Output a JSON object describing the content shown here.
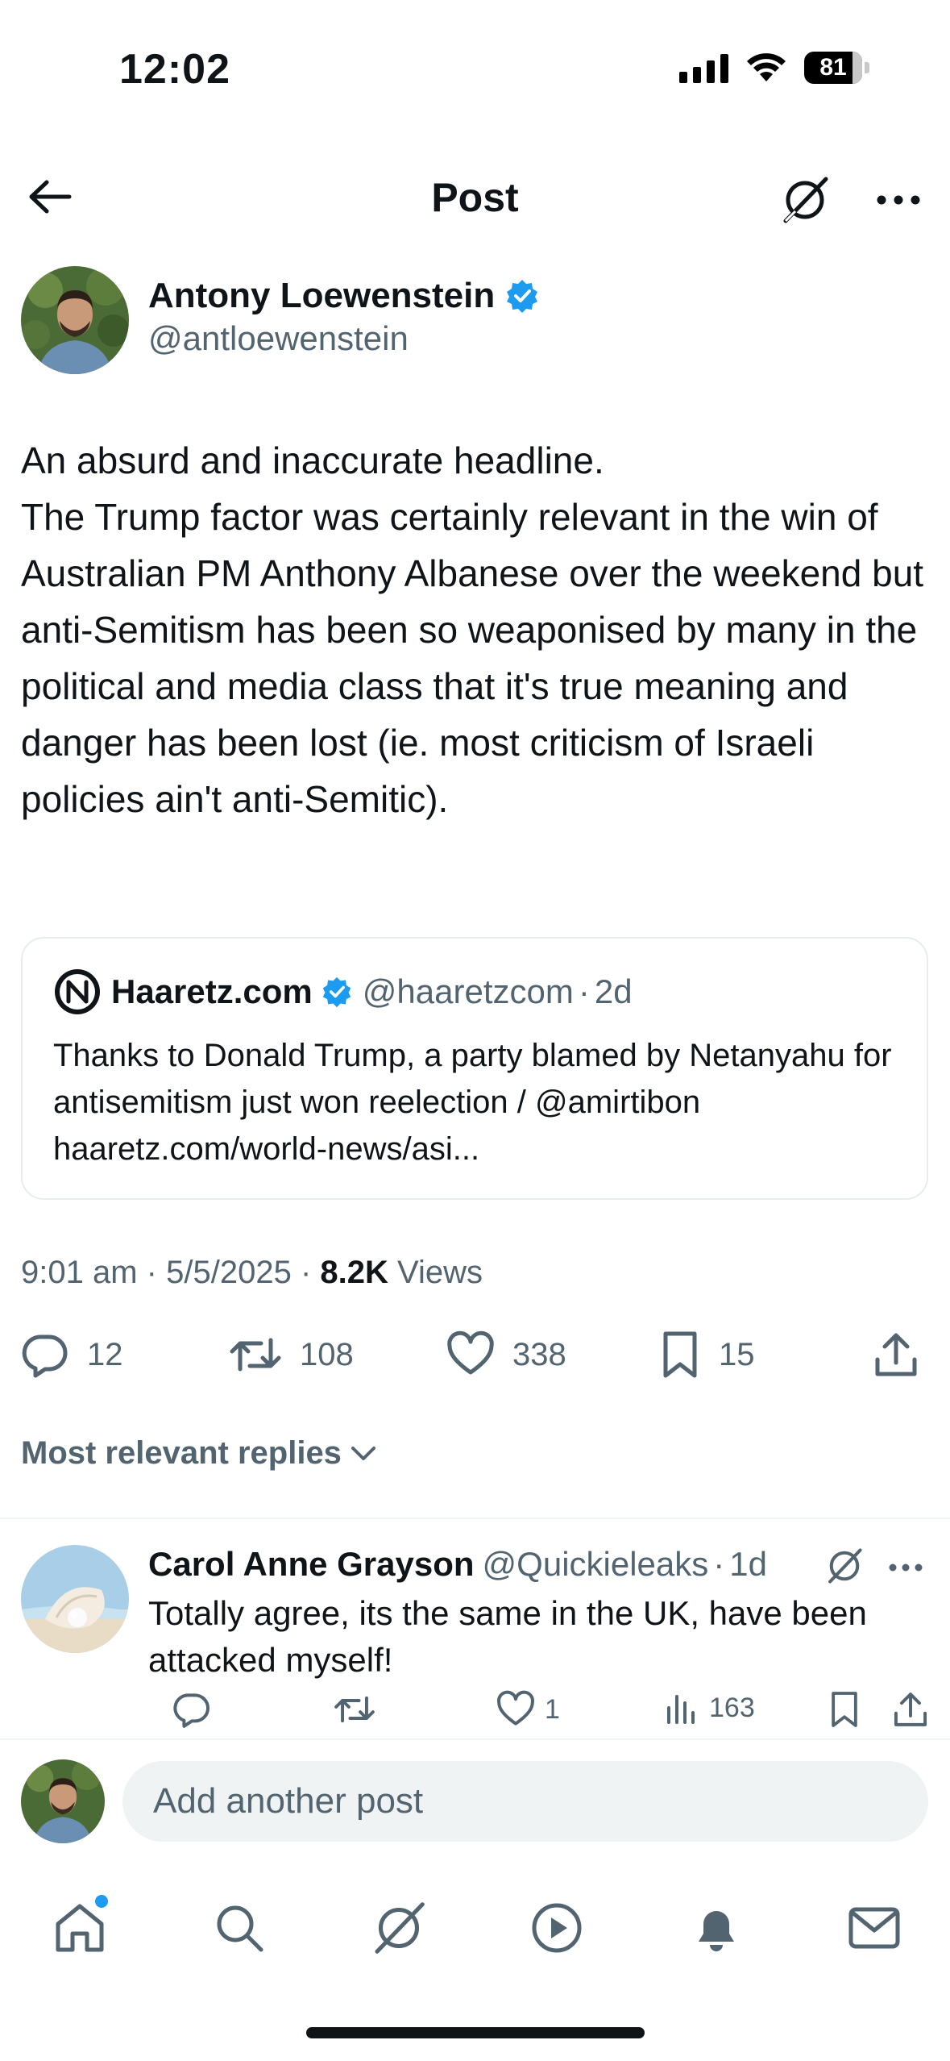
{
  "status_bar": {
    "time": "12:02",
    "battery": "81"
  },
  "header": {
    "title": "Post"
  },
  "author": {
    "name": "Antony Loewenstein",
    "handle": "@antloewenstein"
  },
  "tweet": {
    "text": "An absurd and inaccurate headline.\nThe Trump factor was certainly relevant in the win of Australian PM Anthony Albanese over the weekend but anti-Semitism has been so weaponised by many in the political and media class that it's true meaning and danger has been lost (ie. most criticism of Israeli policies ain't anti-Semitic)."
  },
  "quote": {
    "name": "Haaretz.com",
    "handle": "@haaretzcom",
    "separator": "·",
    "age": "2d",
    "text": "Thanks to Donald Trump, a party blamed by Netanyahu for antisemitism just won reelection / @amirtibon  haaretz.com/world-news/asi..."
  },
  "meta": {
    "time": "9:01 am",
    "sep1": "·",
    "date": "5/5/2025",
    "sep2": "·",
    "views_count": "8.2K",
    "views_label": "Views"
  },
  "actions": {
    "replies": "12",
    "reposts": "108",
    "likes": "338",
    "bookmarks": "15"
  },
  "replies_section": {
    "label": "Most relevant replies"
  },
  "reply": {
    "name": "Carol Anne Grayson",
    "handle": "@Quickieleaks",
    "separator": "·",
    "age": "1d",
    "text": "Totally agree, its the same in the UK, have been attacked myself!",
    "likes": "1",
    "views": "163"
  },
  "compose": {
    "placeholder": "Add another post"
  },
  "colors": {
    "verified": "#1d9bf0",
    "text": "#0f1419",
    "secondary": "#536471",
    "border": "#e6ecf0",
    "input_bg": "#eff3f4"
  },
  "icons": [
    "back-arrow-icon",
    "grok-icon",
    "more-icon",
    "verified-icon",
    "reply-icon",
    "repost-icon",
    "like-icon",
    "bookmark-icon",
    "share-icon",
    "views-icon",
    "chevron-down-icon",
    "home-icon",
    "search-icon",
    "play-icon",
    "bell-icon",
    "mail-icon"
  ]
}
